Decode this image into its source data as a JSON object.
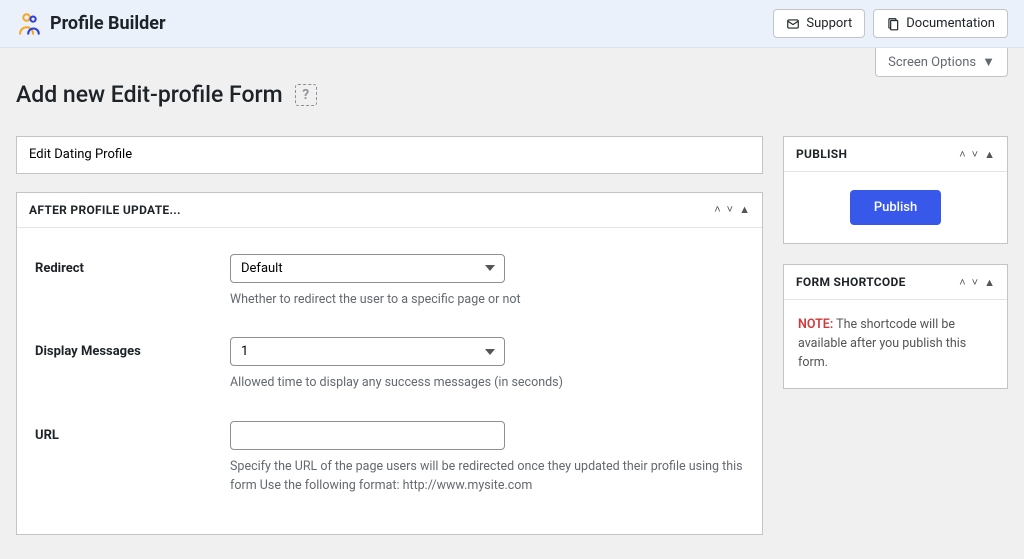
{
  "topbar": {
    "brand": "Profile Builder",
    "support": "Support",
    "documentation": "Documentation"
  },
  "screen_options_label": "Screen Options",
  "page_title": "Add new Edit-profile Form",
  "title_input_value": "Edit Dating Profile",
  "after_panel": {
    "title": "AFTER PROFILE UPDATE...",
    "redirect": {
      "label": "Redirect",
      "value": "Default",
      "desc": "Whether to redirect the user to a specific page or not"
    },
    "display_messages": {
      "label": "Display Messages",
      "value": "1",
      "desc": "Allowed time to display any success messages (in seconds)"
    },
    "url": {
      "label": "URL",
      "value": "",
      "desc": "Specify the URL of the page users will be redirected once they updated their profile using this form Use the following format: http://www.mysite.com"
    }
  },
  "publish_panel": {
    "title": "PUBLISH",
    "button": "Publish"
  },
  "shortcode_panel": {
    "title": "FORM SHORTCODE",
    "note_label": "NOTE:",
    "note_text": " The shortcode will be available after you publish this form."
  }
}
